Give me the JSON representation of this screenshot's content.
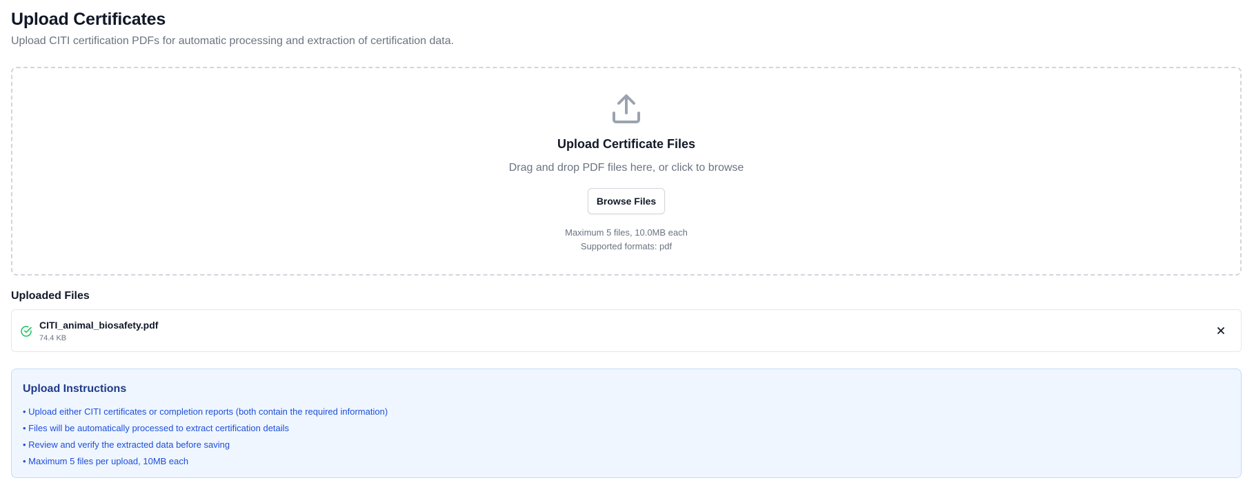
{
  "page": {
    "title": "Upload Certificates",
    "subtitle": "Upload CITI certification PDFs for automatic processing and extraction of certification data."
  },
  "dropzone": {
    "icon": "upload-icon",
    "title": "Upload Certificate Files",
    "subtitle": "Drag and drop PDF files here, or click to browse",
    "browse_label": "Browse Files",
    "limit_text": "Maximum 5 files, 10.0MB each",
    "formats_text": "Supported formats: pdf"
  },
  "uploaded": {
    "heading": "Uploaded Files",
    "files": [
      {
        "name": "CITI_animal_biosafety.pdf",
        "size": "74.4 KB",
        "status_icon": "check-circle-icon",
        "remove_icon": "close-icon"
      }
    ]
  },
  "instructions": {
    "title": "Upload Instructions",
    "items": [
      "Upload either CITI certificates or completion reports (both contain the required information)",
      "Files will be automatically processed to extract certification details",
      "Review and verify the extracted data before saving",
      "Maximum 5 files per upload, 10MB each"
    ]
  },
  "colors": {
    "success": "#22c55e",
    "instructions_bg": "#eff6ff",
    "instructions_text": "#1d4ed8",
    "instructions_title": "#1e3a8a",
    "muted_text": "#6b7280"
  }
}
